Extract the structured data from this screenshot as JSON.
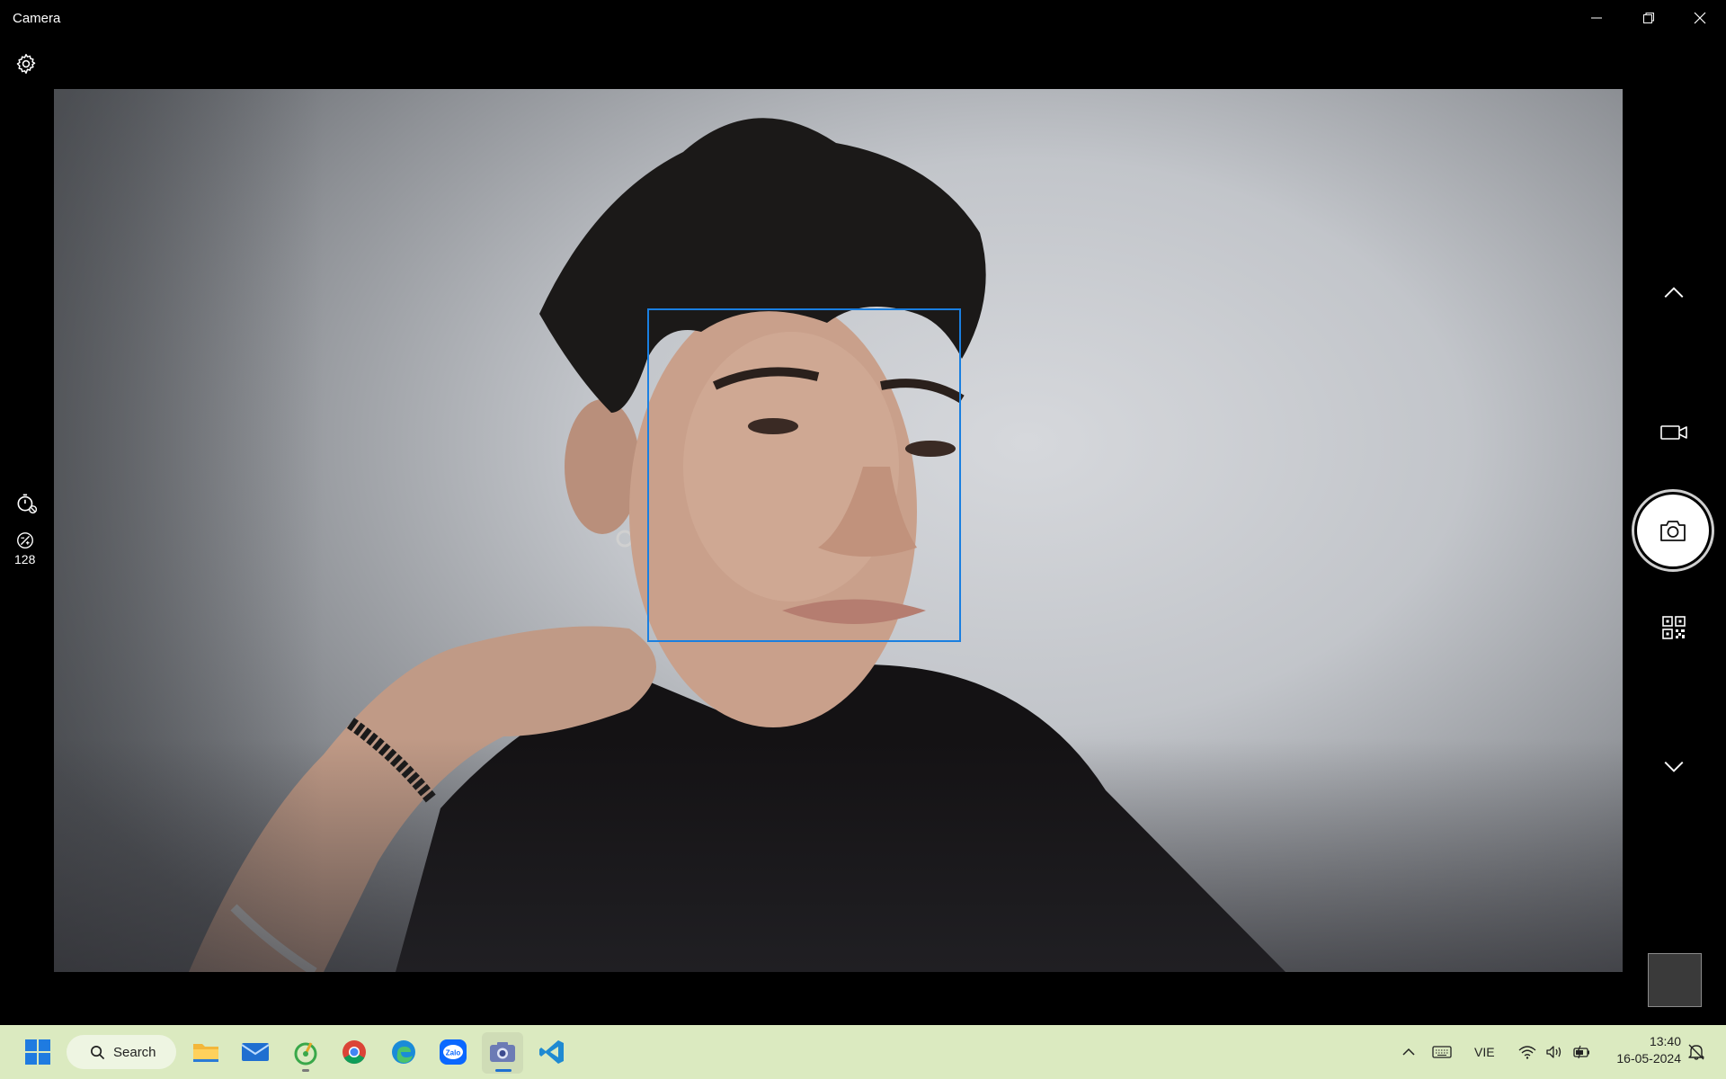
{
  "window": {
    "title": "Camera",
    "controls": [
      "minimize",
      "restore",
      "close"
    ]
  },
  "left_toolbar": {
    "settings_icon": "gear-icon",
    "timer_icon": "timer-off-icon",
    "brightness_icon": "brightness-icon",
    "brightness_value": "128"
  },
  "viewport": {
    "content": "live-camera-feed",
    "face_detection_color": "#1a7fe0"
  },
  "right_toolbar": {
    "items": [
      "chevron-up-icon",
      "video-mode-icon",
      "photo-shutter-button",
      "qr-scan-icon",
      "chevron-down-icon"
    ]
  },
  "taskbar": {
    "search_label": "Search",
    "apps": [
      "start-icon",
      "file-explorer-icon",
      "mail-icon",
      "app-icon",
      "chrome-icon",
      "edge-icon",
      "zalo-icon",
      "camera-icon",
      "vscode-icon"
    ],
    "zalo_label": "Zalo",
    "language": "VIE",
    "time": "13:40",
    "date": "16-05-2024",
    "colors": {
      "taskbar_bg": "#dbeac0",
      "accent": "#1a7fe0"
    }
  }
}
